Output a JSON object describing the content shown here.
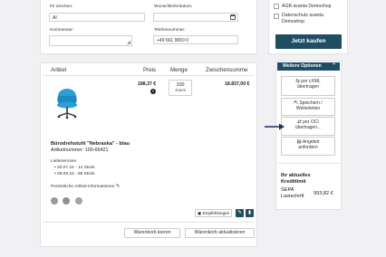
{
  "form": {
    "ihr_zeichen_label": "Ihr Zeichen:",
    "ihr_zeichen_value": "AI",
    "wunschlieferdatum_label": "Wunschlieferdatum:",
    "kommentar_label": "Kommentar:",
    "telefon_label": "Telefonnummer:",
    "telefon_value": "+49 661 9650 0"
  },
  "sidebar": {
    "agb_label": "AGB avanta Demoshop",
    "datenschutz_label_1": "Datenschutz avanta",
    "datenschutz_label_2": "Demoshop",
    "buy_button": "Jetzt kaufen",
    "options_title": "Weitere Optionen",
    "options_chevron": "^",
    "options": [
      {
        "icon": "link-icon",
        "glyph": "⇆",
        "line1": "per cXML",
        "line2": "übertragen"
      },
      {
        "icon": "share-icon",
        "glyph": "⇱",
        "line1": "Speichern /",
        "line2": "Weiterleiten"
      },
      {
        "icon": "transfer-icon",
        "glyph": "⇄",
        "line1": "per OCI",
        "line2": "übertragen..."
      },
      {
        "icon": "document-icon",
        "glyph": "▤",
        "line1": "Angebot",
        "line2": "anfordern"
      }
    ],
    "credit_title_1": "Ihr aktuelles",
    "credit_title_2": "Kreditlimit",
    "credit_method_1": "SEPA",
    "credit_method_2": "Lastschrift",
    "credit_amount": "993,82 €"
  },
  "cart": {
    "headers": {
      "artikel": "Artikel",
      "preis": "Preis",
      "menge": "Menge",
      "zwischensumme": "Zwischensumme"
    },
    "item": {
      "price": "188,37 €",
      "qty_value": "100",
      "qty_unit": "Stück",
      "subtotal": "18.837,00 €",
      "name": "Bürodrehstuhl \"Nebraska\" - blau",
      "article_no": "Artikelnummer: 100-65421",
      "delivery_title": "Liefertermine",
      "deliveries": [
        "20.07.24 - 14 Stück",
        "09.08.24 - 86 Stück"
      ],
      "personal_info": "Persönliche Artikel-Informationen"
    },
    "recommend_label": "Empfehlungen",
    "clear_button": "Warenkorb leeren",
    "update_button": "Warenkorb aktualisieren"
  },
  "colors": {
    "primary": "#1f4e63",
    "chair_blue": "#2b9fd8",
    "background": "#f1f1f3",
    "annotation_arrow": "#1f2f5a"
  }
}
